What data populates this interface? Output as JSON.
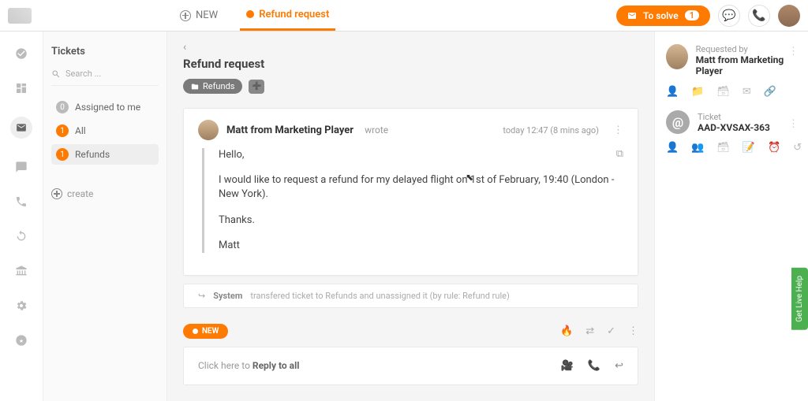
{
  "header": {
    "new_tab": "NEW",
    "active_tab": "Refund request",
    "to_solve_label": "To solve",
    "to_solve_count": "1"
  },
  "sidebar": {
    "title": "Tickets",
    "search_placeholder": "Search ...",
    "filters": [
      {
        "count": "0",
        "label": "Assigned to me",
        "color": "grey"
      },
      {
        "count": "1",
        "label": "All",
        "color": "orange"
      },
      {
        "count": "1",
        "label": "Refunds",
        "color": "orange"
      }
    ],
    "create_label": "create"
  },
  "ticket": {
    "title": "Refund request",
    "tag": "Refunds",
    "from": "Matt from Marketing Player",
    "wrote": "wrote",
    "time": "today 12:47 (8 mins ago)",
    "body": {
      "p1": "Hello,",
      "p2": "I would like to request a refund for my delayed flight on 1st of February, 19:40 (London - New York).",
      "p3": "Thanks.",
      "p4": "Matt"
    },
    "system_label": "System",
    "system_text": "transfered ticket to Refunds and unassigned it (by rule: Refund rule)",
    "status_new": "NEW",
    "reply_prefix": "Click here to ",
    "reply_action": "Reply to all"
  },
  "panel": {
    "requested_label": "Requested by",
    "requested_name": "Matt from Marketing Player",
    "ticket_label": "Ticket",
    "ticket_code": "AAD-XVSAX-363"
  },
  "live_help": "Get Live Help"
}
